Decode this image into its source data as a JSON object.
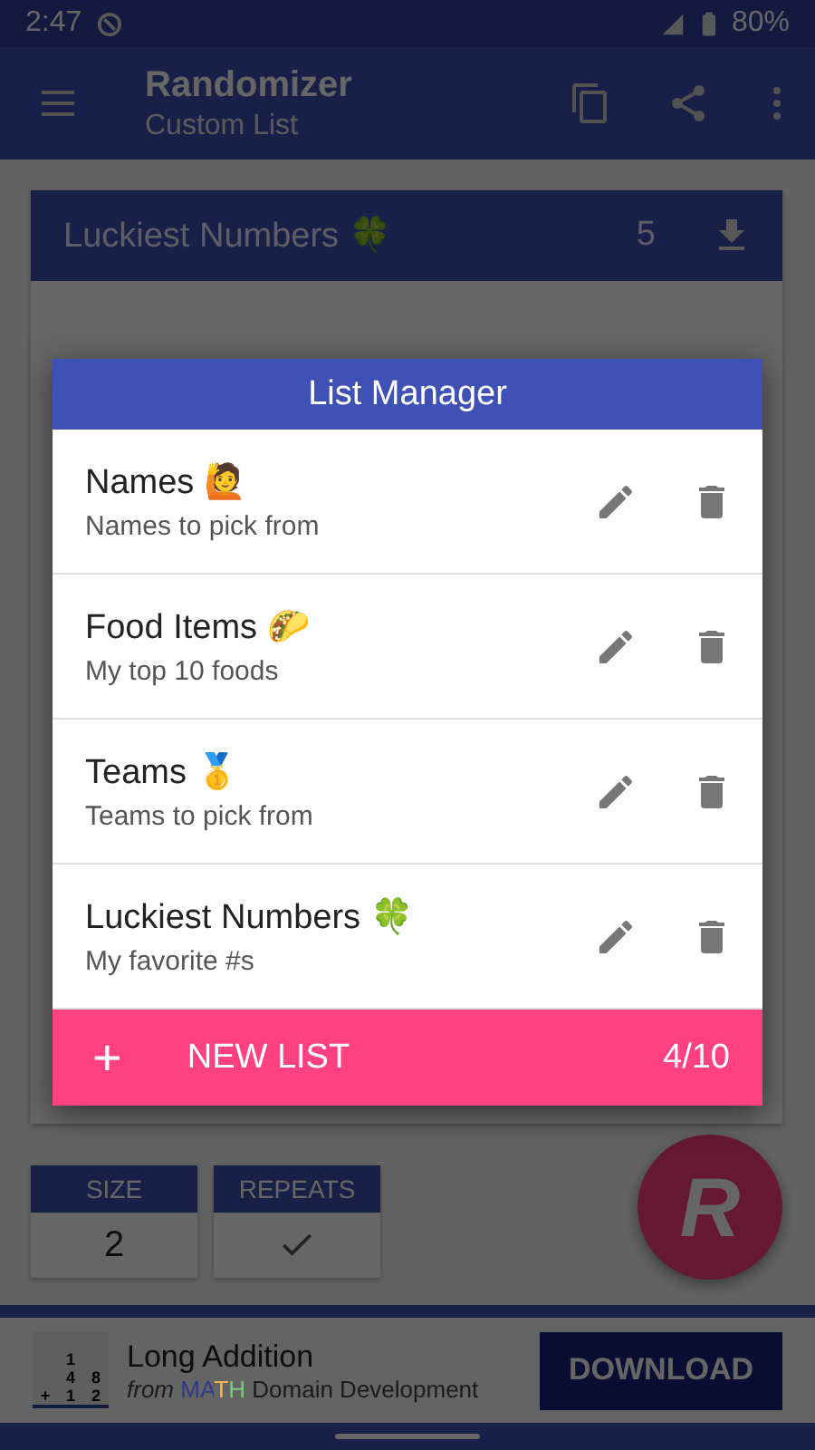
{
  "status_bar": {
    "time": "2:47",
    "battery": "80%"
  },
  "app_bar": {
    "title": "Randomizer",
    "subtitle": "Custom List"
  },
  "current_list": {
    "name": "Luckiest Numbers 🍀",
    "count": "5"
  },
  "settings": [
    {
      "label": "SIZE",
      "kind": "value",
      "value": "2"
    },
    {
      "label": "REPEATS",
      "kind": "check",
      "checked": true
    }
  ],
  "fab": {
    "label": "R"
  },
  "ad": {
    "icon_cells": [
      "1",
      "4",
      "8",
      "+",
      "1",
      "2"
    ],
    "title": "Long Addition",
    "from": "from",
    "brand": [
      {
        "text": "M",
        "color": "#2e3a86"
      },
      {
        "text": "A",
        "color": "#2e3a86"
      },
      {
        "text": "T",
        "color": "#ffb74d"
      },
      {
        "text": "H",
        "color": "#81c784"
      }
    ],
    "developer": "Domain Development",
    "button": "DOWNLOAD"
  },
  "dialog": {
    "title": "List Manager",
    "lists": [
      {
        "name": "Names 🙋",
        "description": "Names to pick from"
      },
      {
        "name": "Food Items 🌮",
        "description": "My top 10 foods"
      },
      {
        "name": "Teams 🥇",
        "description": "Teams to pick from"
      },
      {
        "name": "Luckiest Numbers 🍀",
        "description": "My favorite #s"
      }
    ],
    "new_button": "NEW LIST",
    "plus": "+",
    "counter": "4/10"
  }
}
